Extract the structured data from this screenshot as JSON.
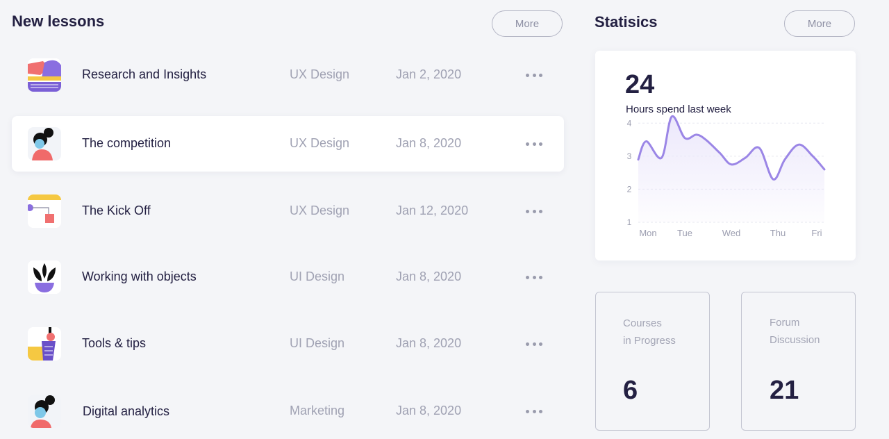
{
  "new_lessons": {
    "title": "New lessons",
    "more_label": "More",
    "items": [
      {
        "title": "Research and Insights",
        "category": "UX Design",
        "date": "Jan 2, 2020",
        "thumb": "research-thumbnail"
      },
      {
        "title": "The competition",
        "category": "UX Design",
        "date": "Jan 8, 2020",
        "thumb": "competition-thumbnail"
      },
      {
        "title": "The Kick Off",
        "category": "UX Design",
        "date": "Jan 12, 2020",
        "thumb": "kickoff-thumbnail"
      },
      {
        "title": "Working with objects",
        "category": "UI Design",
        "date": "Jan 8, 2020",
        "thumb": "objects-thumbnail"
      },
      {
        "title": "Tools & tips",
        "category": "UI Design",
        "date": "Jan 8, 2020",
        "thumb": "tools-thumbnail"
      },
      {
        "title": "Digital analytics",
        "category": "Marketing",
        "date": "Jan 8, 2020",
        "thumb": "analytics-thumbnail"
      }
    ]
  },
  "statistics": {
    "title": "Statisics",
    "more_label": "More",
    "hours_value": "24",
    "hours_label": "Hours spend last week"
  },
  "chart_data": {
    "type": "line",
    "categories": [
      "Mon",
      "Tue",
      "Wed",
      "Thu",
      "Fri"
    ],
    "x": [
      0,
      0.17,
      0.5,
      0.72,
      1,
      1.25,
      1.45,
      1.75,
      2,
      2.3,
      2.6,
      2.9,
      3.15,
      3.45,
      3.75,
      4
    ],
    "series": [
      {
        "values": [
          2.9,
          3.45,
          2.95,
          4.2,
          3.55,
          3.65,
          3.5,
          3.1,
          2.75,
          2.95,
          3.25,
          2.3,
          2.9,
          3.35,
          3.0,
          2.6
        ]
      }
    ],
    "yticks": [
      1,
      2,
      3,
      4
    ],
    "ylim": [
      1,
      4.3
    ],
    "grid": true,
    "line_color": "#9b86e6",
    "fill_color": "#ece8fb"
  },
  "courses_card": {
    "label_line1": "Courses",
    "label_line2": "in Progress",
    "value": "6"
  },
  "forum_card": {
    "label_line1": "Forum",
    "label_line2": "Discussion",
    "value": "21"
  }
}
